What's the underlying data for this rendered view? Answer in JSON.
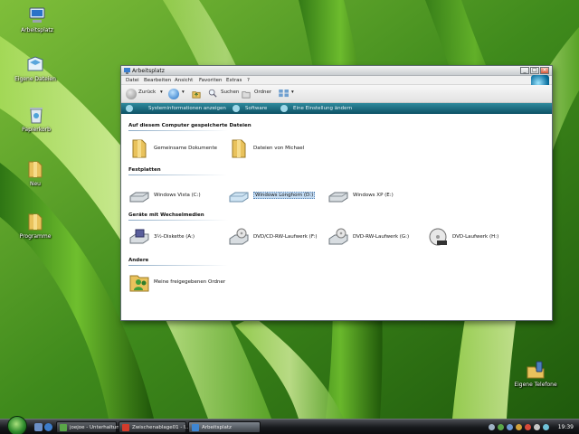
{
  "desktop": {
    "icons": [
      {
        "label": "Arbeitsplatz",
        "icon": "computer-icon"
      },
      {
        "label": "Eigene Dateien",
        "icon": "my-files-icon"
      },
      {
        "label": "Papierkorb",
        "icon": "recycle-bin-icon"
      },
      {
        "label": "Neu",
        "icon": "folder-icon"
      },
      {
        "label": "Programme",
        "icon": "folder-icon"
      },
      {
        "label": "Eigene Telefone",
        "icon": "phone-folder-icon"
      }
    ]
  },
  "window": {
    "title": "Arbeitsplatz",
    "buttons": {
      "minimize": "_",
      "maximize": "□",
      "close": "×"
    },
    "menu": [
      "Datei",
      "Bearbeiten",
      "Ansicht",
      "Favoriten",
      "Extras",
      "?"
    ],
    "toolbar": {
      "back": "Zurück",
      "search": "Suchen",
      "folders": "Ordner"
    },
    "taskpane": [
      "Systeminformationen anzeigen",
      "Software",
      "Eine Einstellung ändern"
    ],
    "groups": [
      {
        "title": "Auf diesem Computer gespeicherte Dateien",
        "items": [
          {
            "label": "Gemeinsame Dokumente",
            "icon": "shared-folder-icon"
          },
          {
            "label": "Dateien von Michael",
            "icon": "user-folder-icon"
          }
        ]
      },
      {
        "title": "Festplatten",
        "items": [
          {
            "label": "Windows Vista (C:)",
            "icon": "hard-drive-icon"
          },
          {
            "label": "Windows Longhorn (D:)",
            "icon": "hard-drive-icon"
          },
          {
            "label": "Windows XP (E:)",
            "icon": "hard-drive-icon"
          }
        ]
      },
      {
        "title": "Geräte mit Wechselmedien",
        "items": [
          {
            "label": "3½-Diskette (A:)",
            "icon": "floppy-drive-icon"
          },
          {
            "label": "DVD/CD-RW-Laufwerk (F:)",
            "icon": "dvd-cd-rw-drive-icon"
          },
          {
            "label": "DVD-RW-Laufwerk (G:)",
            "icon": "dvd-rw-drive-icon"
          },
          {
            "label": "DVD-Laufwerk (H:)",
            "icon": "dvd-drive-icon"
          }
        ]
      },
      {
        "title": "Andere",
        "items": [
          {
            "label": "Meine freigegebenen Ordner",
            "icon": "shared-folders-icon"
          }
        ]
      }
    ]
  },
  "taskbar": {
    "tasks": [
      {
        "label": "joejoe - Unterhaltung",
        "icon": "messenger-icon"
      },
      {
        "label": "Zwischenablage01 - I...",
        "icon": "paint-icon"
      },
      {
        "label": "Arbeitsplatz",
        "icon": "explorer-icon"
      }
    ],
    "clock": "19:39"
  },
  "colors": {
    "taskpane": "#1b6f83",
    "selection": "#c4dcf3",
    "folder": "#e9c25c"
  }
}
